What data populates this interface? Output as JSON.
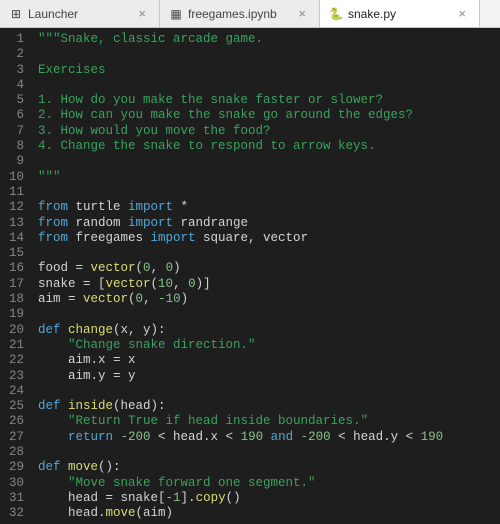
{
  "tabs": [
    {
      "label": "Launcher",
      "icon": "launcher-icon",
      "active": false
    },
    {
      "label": "freegames.ipynb",
      "icon": "notebook-icon",
      "active": false
    },
    {
      "label": "snake.py",
      "icon": "python-icon",
      "active": true
    }
  ],
  "tab_close_glyph": "×",
  "icons": {
    "launcher-icon": "⊞",
    "notebook-icon": "▦",
    "python-icon": "🐍"
  },
  "colors": {
    "editor_bg": "#1e1e1e",
    "gutter_fg": "#858585",
    "string": "#38a35c",
    "keyword": "#4fa8d8",
    "func": "#dadb74",
    "number": "#87c38a",
    "builtin": "#3fbab5"
  },
  "code_lines": [
    [
      {
        "t": "\"\"\"Snake, classic arcade game.",
        "c": "str"
      }
    ],
    [],
    [
      {
        "t": "Exercises",
        "c": "str"
      }
    ],
    [],
    [
      {
        "t": "1. How do you make the snake faster or slower?",
        "c": "str"
      }
    ],
    [
      {
        "t": "2. How can you make the snake go around the edges?",
        "c": "str"
      }
    ],
    [
      {
        "t": "3. How would you move the food?",
        "c": "str"
      }
    ],
    [
      {
        "t": "4. Change the snake to respond to arrow keys.",
        "c": "str"
      }
    ],
    [],
    [
      {
        "t": "\"\"\"",
        "c": "str"
      }
    ],
    [],
    [
      {
        "t": "from ",
        "c": "key"
      },
      {
        "t": "turtle ",
        "c": "ident"
      },
      {
        "t": "import ",
        "c": "key"
      },
      {
        "t": "*",
        "c": "punct"
      }
    ],
    [
      {
        "t": "from ",
        "c": "key"
      },
      {
        "t": "random ",
        "c": "ident"
      },
      {
        "t": "import ",
        "c": "key"
      },
      {
        "t": "randrange",
        "c": "ident"
      }
    ],
    [
      {
        "t": "from ",
        "c": "key"
      },
      {
        "t": "freegames ",
        "c": "ident"
      },
      {
        "t": "import ",
        "c": "key"
      },
      {
        "t": "square, vector",
        "c": "ident"
      }
    ],
    [],
    [
      {
        "t": "food = ",
        "c": "ident"
      },
      {
        "t": "vector",
        "c": "def"
      },
      {
        "t": "(",
        "c": "punct"
      },
      {
        "t": "0",
        "c": "num"
      },
      {
        "t": ", ",
        "c": "punct"
      },
      {
        "t": "0",
        "c": "num"
      },
      {
        "t": ")",
        "c": "punct"
      }
    ],
    [
      {
        "t": "snake = [",
        "c": "ident"
      },
      {
        "t": "vector",
        "c": "def"
      },
      {
        "t": "(",
        "c": "punct"
      },
      {
        "t": "10",
        "c": "num"
      },
      {
        "t": ", ",
        "c": "punct"
      },
      {
        "t": "0",
        "c": "num"
      },
      {
        "t": ")]",
        "c": "punct"
      }
    ],
    [
      {
        "t": "aim = ",
        "c": "ident"
      },
      {
        "t": "vector",
        "c": "def"
      },
      {
        "t": "(",
        "c": "punct"
      },
      {
        "t": "0",
        "c": "num"
      },
      {
        "t": ", ",
        "c": "punct"
      },
      {
        "t": "-10",
        "c": "num"
      },
      {
        "t": ")",
        "c": "punct"
      }
    ],
    [],
    [
      {
        "t": "def ",
        "c": "key"
      },
      {
        "t": "change",
        "c": "def"
      },
      {
        "t": "(x, y):",
        "c": "punct"
      }
    ],
    [
      {
        "t": "    ",
        "c": "ident"
      },
      {
        "t": "\"Change snake direction.\"",
        "c": "str"
      }
    ],
    [
      {
        "t": "    aim.x = x",
        "c": "ident"
      }
    ],
    [
      {
        "t": "    aim.y = y",
        "c": "ident"
      }
    ],
    [],
    [
      {
        "t": "def ",
        "c": "key"
      },
      {
        "t": "inside",
        "c": "def"
      },
      {
        "t": "(head):",
        "c": "punct"
      }
    ],
    [
      {
        "t": "    ",
        "c": "ident"
      },
      {
        "t": "\"Return True if head inside boundaries.\"",
        "c": "str"
      }
    ],
    [
      {
        "t": "    ",
        "c": "ident"
      },
      {
        "t": "return ",
        "c": "key"
      },
      {
        "t": "-200",
        "c": "num"
      },
      {
        "t": " < head.x < ",
        "c": "ident"
      },
      {
        "t": "190",
        "c": "num"
      },
      {
        "t": " ",
        "c": "ident"
      },
      {
        "t": "and ",
        "c": "key"
      },
      {
        "t": "-200",
        "c": "num"
      },
      {
        "t": " < head.y < ",
        "c": "ident"
      },
      {
        "t": "190",
        "c": "num"
      }
    ],
    [],
    [
      {
        "t": "def ",
        "c": "key"
      },
      {
        "t": "move",
        "c": "def"
      },
      {
        "t": "():",
        "c": "punct"
      }
    ],
    [
      {
        "t": "    ",
        "c": "ident"
      },
      {
        "t": "\"Move snake forward one segment.\"",
        "c": "str"
      }
    ],
    [
      {
        "t": "    head = snake[",
        "c": "ident"
      },
      {
        "t": "-1",
        "c": "num"
      },
      {
        "t": "].",
        "c": "punct"
      },
      {
        "t": "copy",
        "c": "def"
      },
      {
        "t": "()",
        "c": "punct"
      }
    ],
    [
      {
        "t": "    head.",
        "c": "ident"
      },
      {
        "t": "move",
        "c": "def"
      },
      {
        "t": "(aim)",
        "c": "punct"
      }
    ]
  ]
}
